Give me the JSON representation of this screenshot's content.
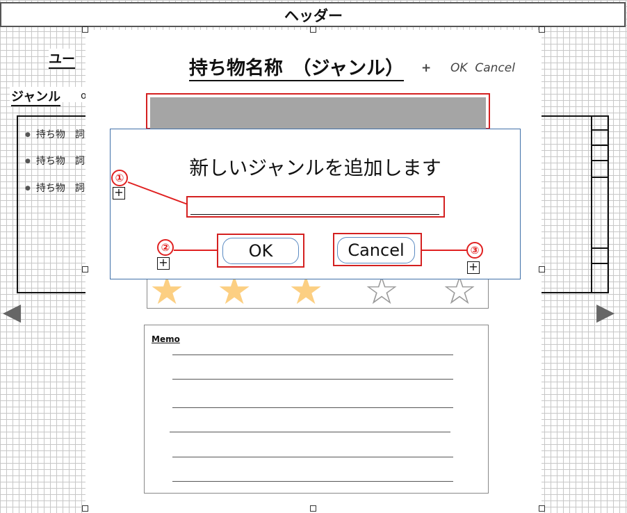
{
  "header": {
    "title": "ヘッダー"
  },
  "background": {
    "user_label": "ユー",
    "genre_label": "ジャンル",
    "genre_suffix": "o",
    "list_items": [
      {
        "label": "持ち物",
        "suffix": "詞"
      },
      {
        "label": "持ち物",
        "suffix": "詞"
      },
      {
        "label": "持ち物",
        "suffix": "詞"
      }
    ],
    "arrow_left": "◀",
    "arrow_right": "▶"
  },
  "card": {
    "title": "持ち物名称　（ジャンル）",
    "title_plus": "+",
    "actions": "OK  Cancel",
    "rating": {
      "value": 3,
      "max": 5,
      "full_color": "#fccf82",
      "empty_color": "#9a9a9a"
    },
    "memo_label": "Memo"
  },
  "dialog": {
    "title": "新しいジャンルを追加します",
    "input_value": "",
    "ok_label": "OK",
    "cancel_label": "Cancel"
  },
  "annotations": {
    "markers": [
      "①",
      "②",
      "③"
    ],
    "plus": "+",
    "color": "#e02020"
  }
}
